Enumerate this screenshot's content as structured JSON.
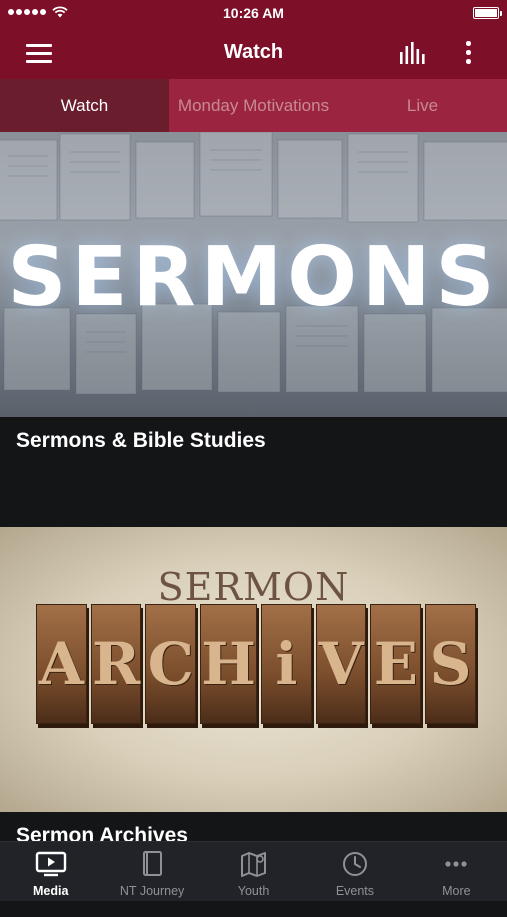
{
  "status_bar": {
    "time": "10:26 AM"
  },
  "app_bar": {
    "title": "Watch"
  },
  "tabs": [
    {
      "label": "Watch",
      "active": true
    },
    {
      "label": "Monday Motivations",
      "active": false
    },
    {
      "label": "Live",
      "active": false
    }
  ],
  "cards": [
    {
      "image_text": "SERMONS",
      "title": "Sermons & Bible Studies"
    },
    {
      "image_text_top": "SERMON",
      "image_letters": [
        "A",
        "R",
        "C",
        "H",
        "i",
        "V",
        "E",
        "S"
      ],
      "title": "Sermon Archives"
    }
  ],
  "bottom_nav": [
    {
      "label": "Media",
      "icon": "media-icon",
      "active": true
    },
    {
      "label": "NT Journey",
      "icon": "book-icon",
      "active": false
    },
    {
      "label": "Youth",
      "icon": "map-icon",
      "active": false
    },
    {
      "label": "Events",
      "icon": "clock-icon",
      "active": false
    },
    {
      "label": "More",
      "icon": "more-dots-icon",
      "active": false
    }
  ],
  "colors": {
    "brand": "#7d0f28",
    "tab_bar": "#9b2540",
    "tab_active": "#6a1e2d",
    "nav_background": "#212328",
    "caption_background": "#141517"
  }
}
